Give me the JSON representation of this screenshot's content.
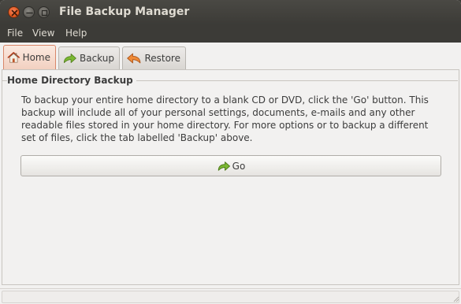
{
  "window": {
    "title": "File Backup Manager"
  },
  "menubar": {
    "items": [
      {
        "label": "File"
      },
      {
        "label": "View"
      },
      {
        "label": "Help"
      }
    ]
  },
  "tabs": [
    {
      "label": "Home",
      "icon": "home-icon",
      "active": true
    },
    {
      "label": "Backup",
      "icon": "forward-arrow-icon",
      "active": false
    },
    {
      "label": "Restore",
      "icon": "back-arrow-icon",
      "active": false
    }
  ],
  "home": {
    "section_title": "Home Directory Backup",
    "description": "To backup your entire home directory to a blank CD or DVD, click the 'Go' button. This backup will include all of your personal settings, documents, e-mails and any other readable files stored in your home directory. For more options or to backup a different set of files, click the tab labelled 'Backup' above.",
    "go_button_label": "Go",
    "go_button_icon": "forward-arrow-icon"
  },
  "colors": {
    "titlebar": "#3c3b37",
    "title_text": "#dfdbd2",
    "close_button": "#e0581f",
    "window_bg": "#f2f1f0",
    "active_tab_border": "#d9876a",
    "arrow_green": "#6fa82a",
    "arrow_orange": "#e07a2a"
  }
}
